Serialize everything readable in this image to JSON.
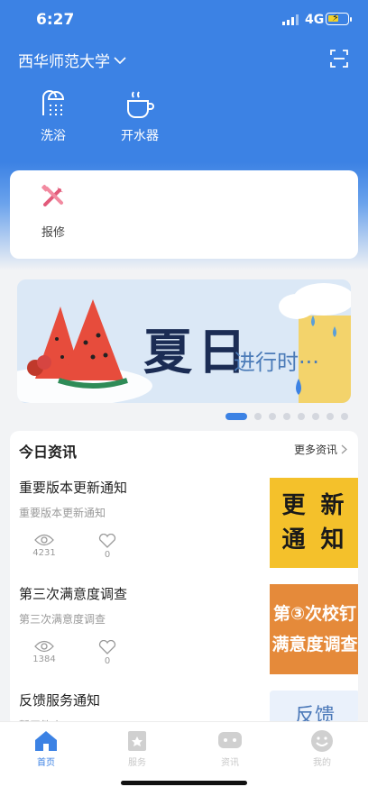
{
  "status_bar": {
    "time": "6:27",
    "network": "4G"
  },
  "header": {
    "school_name": "西华师范大学"
  },
  "quick_actions": [
    {
      "label": "洗浴",
      "icon": "shower-icon"
    },
    {
      "label": "开水器",
      "icon": "water-heater-icon"
    }
  ],
  "services": [
    {
      "label": "报修",
      "icon": "repair-tools-icon"
    }
  ],
  "banner": {
    "title": "夏日",
    "subtitle": "进行时···",
    "page_count": 8,
    "active_index": 0
  },
  "news": {
    "heading": "今日资讯",
    "more_label": "更多资讯",
    "items": [
      {
        "title": "重要版本更新通知",
        "summary": "重要版本更新通知",
        "views": "4231",
        "likes": "0",
        "thumb_line1": "更 新",
        "thumb_line2": "通 知"
      },
      {
        "title": "第三次满意度调查",
        "summary": "第三次满意度调查",
        "views": "1384",
        "likes": "0",
        "thumb_line1": "第③次校钉",
        "thumb_line2": "满意度调查"
      },
      {
        "title": "反馈服务通知",
        "summary": "暂无简介",
        "thumb_line1": "反馈"
      }
    ]
  },
  "tabbar": [
    {
      "label": "首页",
      "active": true
    },
    {
      "label": "服务"
    },
    {
      "label": "资讯"
    },
    {
      "label": "我的"
    }
  ],
  "colors": {
    "primary": "#3c82e4",
    "thumb_yellow": "#f4c12b",
    "thumb_orange": "#e58a3a"
  }
}
